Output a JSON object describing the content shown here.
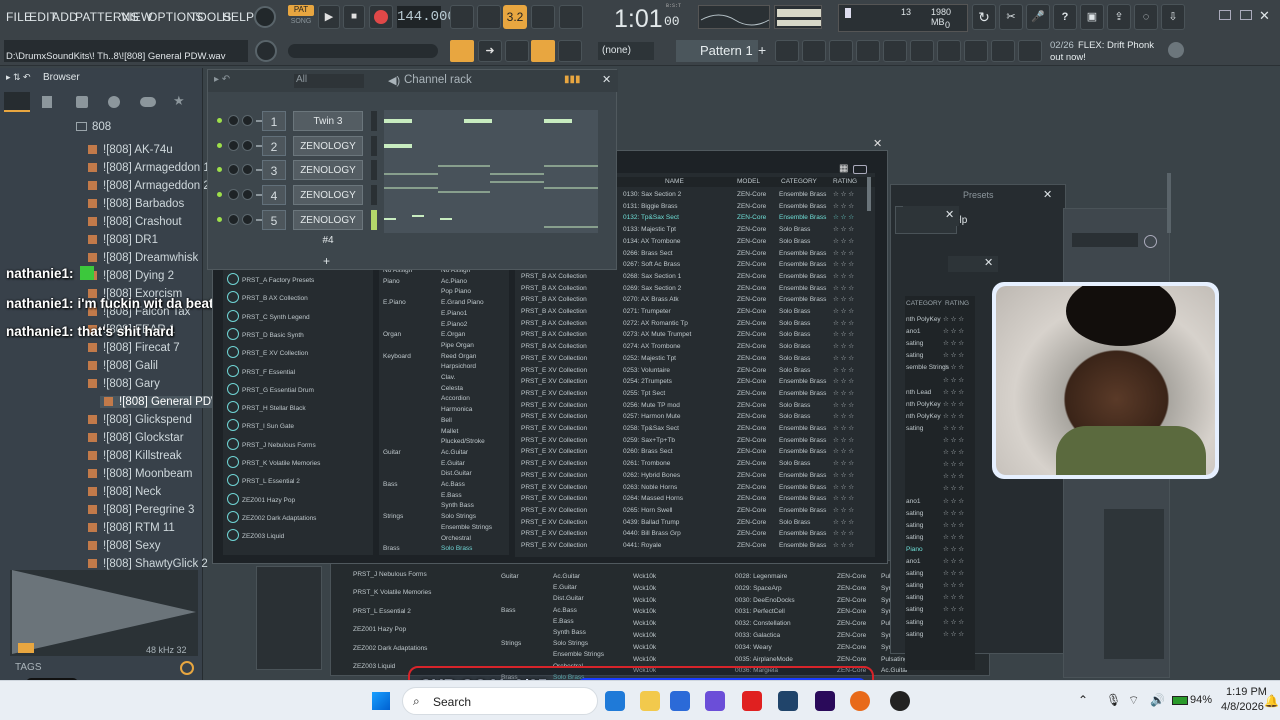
{
  "menu": {
    "items": [
      "FILE",
      "EDIT",
      "ADD",
      "PATTERNS",
      "VIEW",
      "OPTIONS",
      "TOOLS",
      "HELP"
    ]
  },
  "transport": {
    "pat_label": "PAT",
    "song_label": "SONG",
    "tempo": "144.000",
    "time": "1:01",
    "time_small": "00",
    "bst": "B:S:T",
    "mem_mb": "1980 MB",
    "cpu_num": "13",
    "cpu_zero": "0",
    "step_label": "3.2"
  },
  "hint": {
    "path": "D:\\DrumxSoundKits\\! Th..8\\![808] General PDW.wav",
    "none_label": "(none)",
    "pattern": "Pattern 1",
    "news_counter": "02/26",
    "news_text": "FLEX: Drift Phonk",
    "news_sub": "out now!"
  },
  "browser": {
    "title": "Browser",
    "folder": "808",
    "items": [
      "![808] AK-74u",
      "![808] Armageddon 1",
      "![808] Armageddon 2",
      "![808] Barbados",
      "![808] Crashout",
      "![808] DR1",
      "![808] Dreamwhisk",
      "![808] Dying 2",
      "![808] Exorcism",
      "![808] Falcon Tax",
      "![808] FEAR 1",
      "![808] Firecat 7",
      "![808] Galil",
      "![808] Gary",
      "![808] General PDW",
      "![808] Glickspend",
      "![808] Glockstar",
      "![808] Killstreak",
      "![808] Moonbeam",
      "![808] Neck",
      "![808] Peregrine 3",
      "![808] RTM 11",
      "![808] Sexy",
      "![808] ShawtyGlick 2"
    ],
    "samplerate": "48 kHz 32",
    "tags_label": "TAGS"
  },
  "chat": [
    {
      "user": "nathanie1:",
      "msg": ""
    },
    {
      "user": "nathanie1:",
      "msg": "i'm fuckin wit da beat"
    },
    {
      "user": "nathanie1:",
      "msg": "that's shit hard"
    }
  ],
  "channel_rack": {
    "title": "Channel rack",
    "filter": "All",
    "channels": [
      {
        "num": "1",
        "name": "Twin 3"
      },
      {
        "num": "2",
        "name": "ZENOLOGY"
      },
      {
        "num": "3",
        "name": "ZENOLOGY #2"
      },
      {
        "num": "4",
        "name": "ZENOLOGY #3"
      },
      {
        "num": "5",
        "name": "ZENOLOGY #4"
      }
    ],
    "add": "+"
  },
  "zen": {
    "headers": [
      "NAME",
      "MODEL",
      "CATEGORY",
      "RATING"
    ],
    "banks": [
      "PRST_A Factory Presets",
      "PRST_B AX Collection",
      "PRST_C Synth Legend",
      "PRST_D Basic Synth",
      "PRST_E XV Collection",
      "PRST_F Essential",
      "PRST_G Essential Drum",
      "PRST_H Stellar Black",
      "PRST_I Sun Gate",
      "PRST_J Nebulous Forms",
      "PRST_K Volatile Memories",
      "PRST_L Essential 2",
      "ZEZ001 Hazy Pop",
      "ZEZ002 Dark Adaptations",
      "ZEZ003 Liquid"
    ],
    "categories": [
      [
        "No Assign",
        "No Assign"
      ],
      [
        "Piano",
        "Ac.Piano"
      ],
      [
        "",
        "Pop Piano"
      ],
      [
        "E.Piano",
        "E.Grand Piano"
      ],
      [
        "",
        "E.Piano1"
      ],
      [
        "",
        "E.Piano2"
      ],
      [
        "Organ",
        "E.Organ"
      ],
      [
        "",
        "Pipe Organ"
      ],
      [
        "Keyboard",
        "Reed Organ"
      ],
      [
        "",
        "Harpsichord"
      ],
      [
        "",
        "Clav."
      ],
      [
        "",
        "Celesta"
      ],
      [
        "",
        "Accordion"
      ],
      [
        "",
        "Harmonica"
      ],
      [
        "",
        "Bell"
      ],
      [
        "",
        "Mallet"
      ],
      [
        "",
        "Plucked/Stroke"
      ],
      [
        "Guitar",
        "Ac.Guitar"
      ],
      [
        "",
        "E.Guitar"
      ],
      [
        "",
        "Dist.Guitar"
      ],
      [
        "Bass",
        "Ac.Bass"
      ],
      [
        "",
        "E.Bass"
      ],
      [
        "",
        "Synth Bass"
      ],
      [
        "Strings",
        "Solo Strings"
      ],
      [
        "",
        "Ensemble Strings"
      ],
      [
        "",
        "Orchestral"
      ],
      [
        "Brass",
        "Solo Brass"
      ]
    ],
    "rows": [
      [
        "PRST_E XV Collection",
        "0130: Sax Section 2",
        "ZEN-Core",
        "Ensemble Brass"
      ],
      [
        "PRST_E XV Collection",
        "0131: Biggie Brass",
        "ZEN-Core",
        "Ensemble Brass"
      ],
      [
        "PRST_E XV Collection",
        "0132: Tp&Sax Sect",
        "ZEN-Core",
        "Ensemble Brass"
      ],
      [
        "PRST_E XV Collection",
        "0133: Majestic Tpt",
        "ZEN-Core",
        "Solo Brass"
      ],
      [
        "PRST_B AX Collection",
        "0134: AX Trombone",
        "ZEN-Core",
        "Solo Brass"
      ],
      [
        "PRST_B AX Collection",
        "0266: Brass Sect",
        "ZEN-Core",
        "Ensemble Brass"
      ],
      [
        "PRST_B AX Collection",
        "0267: Soft Ac Brass",
        "ZEN-Core",
        "Ensemble Brass"
      ],
      [
        "PRST_B AX Collection",
        "0268: Sax Section 1",
        "ZEN-Core",
        "Ensemble Brass"
      ],
      [
        "PRST_B AX Collection",
        "0269: Sax Section 2",
        "ZEN-Core",
        "Ensemble Brass"
      ],
      [
        "PRST_B AX Collection",
        "0270: AX Brass Atk",
        "ZEN-Core",
        "Ensemble Brass"
      ],
      [
        "PRST_B AX Collection",
        "0271: Trumpeter",
        "ZEN-Core",
        "Solo Brass"
      ],
      [
        "PRST_B AX Collection",
        "0272: AX Romantic Tp",
        "ZEN-Core",
        "Solo Brass"
      ],
      [
        "PRST_B AX Collection",
        "0273: AX Mute Trumpet",
        "ZEN-Core",
        "Solo Brass"
      ],
      [
        "PRST_B AX Collection",
        "0274: AX Trombone",
        "ZEN-Core",
        "Solo Brass"
      ],
      [
        "PRST_E XV Collection",
        "0252: Majestic Tpt",
        "ZEN-Core",
        "Solo Brass"
      ],
      [
        "PRST_E XV Collection",
        "0253: Voluntaire",
        "ZEN-Core",
        "Solo Brass"
      ],
      [
        "PRST_E XV Collection",
        "0254: 2Trumpets",
        "ZEN-Core",
        "Ensemble Brass"
      ],
      [
        "PRST_E XV Collection",
        "0255: Tpt Sect",
        "ZEN-Core",
        "Ensemble Brass"
      ],
      [
        "PRST_E XV Collection",
        "0256: Mute TP mod",
        "ZEN-Core",
        "Solo Brass"
      ],
      [
        "PRST_E XV Collection",
        "0257: Harmon Mute",
        "ZEN-Core",
        "Solo Brass"
      ],
      [
        "PRST_E XV Collection",
        "0258: Tp&Sax Sect",
        "ZEN-Core",
        "Ensemble Brass"
      ],
      [
        "PRST_E XV Collection",
        "0259: Sax+Tp+Tb",
        "ZEN-Core",
        "Ensemble Brass"
      ],
      [
        "PRST_E XV Collection",
        "0260: Brass Sect",
        "ZEN-Core",
        "Ensemble Brass"
      ],
      [
        "PRST_E XV Collection",
        "0261: Trombone",
        "ZEN-Core",
        "Solo Brass"
      ],
      [
        "PRST_E XV Collection",
        "0262: Hybrid Bones",
        "ZEN-Core",
        "Ensemble Brass"
      ],
      [
        "PRST_E XV Collection",
        "0263: Noble Horns",
        "ZEN-Core",
        "Ensemble Brass"
      ],
      [
        "PRST_E XV Collection",
        "0264: Massed Horns",
        "ZEN-Core",
        "Ensemble Brass"
      ],
      [
        "PRST_E XV Collection",
        "0265: Horn Swell",
        "ZEN-Core",
        "Ensemble Brass"
      ],
      [
        "PRST_E XV Collection",
        "0439: Ballad Trump",
        "ZEN-Core",
        "Solo Brass"
      ],
      [
        "PRST_E XV Collection",
        "0440: Bill Brass Grp",
        "ZEN-Core",
        "Ensemble Brass"
      ],
      [
        "PRST_E XV Collection",
        "0441: Royale",
        "ZEN-Core",
        "Ensemble Brass"
      ]
    ],
    "highlight": "0132: Tp&Sax Sect"
  },
  "zen2": {
    "banks": [
      "PRST_J Nebulous Forms",
      "PRST_K Volatile Memories",
      "PRST_L Essential 2",
      "ZEZ001 Hazy Pop",
      "ZEZ002 Dark Adaptations",
      "ZEZ003 Liquid"
    ],
    "cats": [
      [
        "Guitar",
        "Ac.Guitar"
      ],
      [
        "",
        "E.Guitar"
      ],
      [
        "",
        "Dist.Guitar"
      ],
      [
        "Bass",
        "Ac.Bass"
      ],
      [
        "",
        "E.Bass"
      ],
      [
        "",
        "Synth Bass"
      ],
      [
        "Strings",
        "Solo Strings"
      ],
      [
        "",
        "Ensemble Strings"
      ],
      [
        "",
        "Orchestral"
      ],
      [
        "Brass",
        "Solo Brass"
      ]
    ],
    "rows": [
      [
        "Wck10k",
        "0028: Legenmaire",
        "ZEN-Core",
        "Pulsating"
      ],
      [
        "Wck10k",
        "0029: SpaceArp",
        "ZEN-Core",
        "Synth FX"
      ],
      [
        "Wck10k",
        "0030: DeeEnoDocks",
        "ZEN-Core",
        "Synth Pad/Str"
      ],
      [
        "Wck10k",
        "0031: PerfectCell",
        "ZEN-Core",
        "Synth FX"
      ],
      [
        "Wck10k",
        "0032: Constellation",
        "ZEN-Core",
        "Pulsating"
      ],
      [
        "Wck10k",
        "0033: Galactica",
        "ZEN-Core",
        "Synth FX"
      ],
      [
        "Wck10k",
        "0034: Weary",
        "ZEN-Core",
        "Synth Lead"
      ],
      [
        "Wck10k",
        "0035: AirplaneMode",
        "ZEN-Core",
        "Pulsating"
      ],
      [
        "Wck10k",
        "0036: Margiela",
        "ZEN-Core",
        "Ac.Guitar"
      ]
    ]
  },
  "right_panel": {
    "presets_label": "Presets",
    "help_label": "elp",
    "categories_header": "CATEGORY",
    "rating_header": "RATING",
    "cats": [
      "nth PolyKey",
      "ano1",
      "sating",
      "sating",
      "semble Strings",
      "",
      "nth Lead",
      "nth PolyKey",
      "nth PolyKey",
      "sating",
      "",
      "",
      "",
      "",
      "",
      "ano1",
      "sating",
      "sating",
      "sating",
      "Piano",
      "ano1",
      "sating",
      "sating",
      "sating",
      "sating",
      "sating",
      "sating"
    ]
  },
  "overlay": {
    "sub_goal": "SUB GOAL 0/25"
  },
  "taskbar": {
    "search": "Search",
    "battery": "94%",
    "time": "1:19 PM",
    "date": "4/8/2026",
    "kick_count": "6"
  }
}
